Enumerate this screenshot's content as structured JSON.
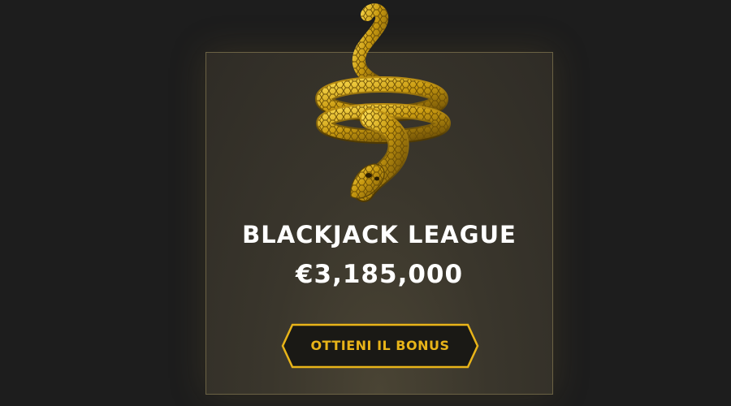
{
  "promo": {
    "title": "BLACKJACK LEAGUE",
    "amount": "€3,185,000",
    "button_label": "OTTIENI IL BONUS",
    "image": "gold-snake-ring-icon"
  },
  "colors": {
    "background": "#1d1d1d",
    "card_border": "#6b6244",
    "accent_gold": "#e8b419",
    "button_fill": "#1a1915",
    "text": "#ffffff"
  }
}
